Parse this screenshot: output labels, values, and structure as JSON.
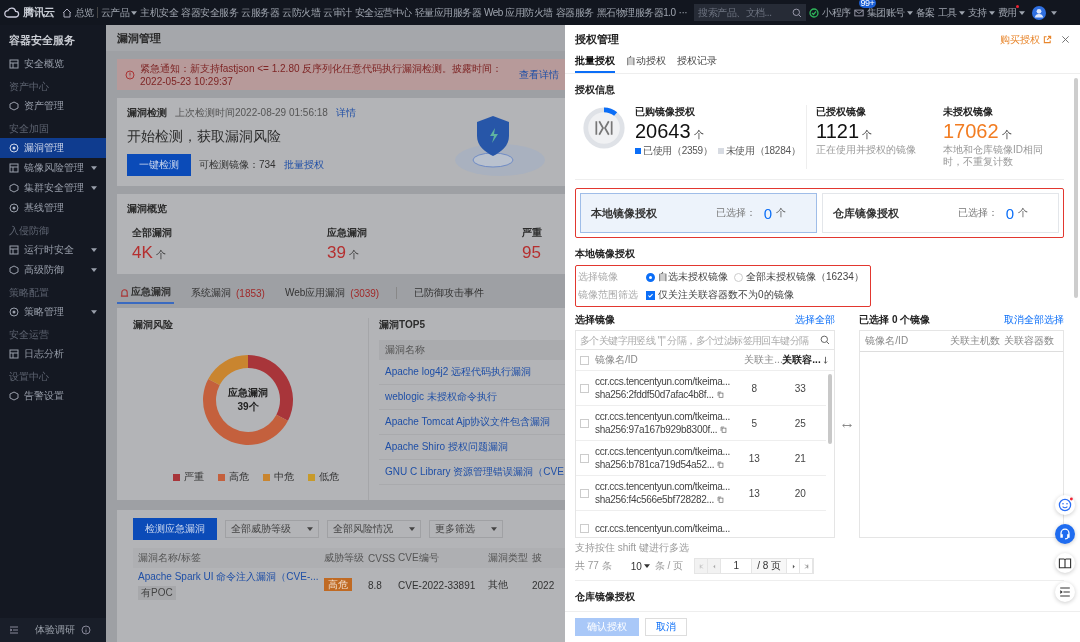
{
  "top_bar": {
    "logo": "腾讯云",
    "home": "总览",
    "nav": [
      {
        "label": "云产品",
        "dropdown": true
      },
      {
        "label": "主机安全",
        "dropdown": false
      },
      {
        "label": "容器安全服务",
        "dropdown": false
      },
      {
        "label": "云服务器",
        "dropdown": false
      },
      {
        "label": "云防火墙",
        "dropdown": false
      },
      {
        "label": "云审计",
        "dropdown": false
      },
      {
        "label": "安全运营中心",
        "dropdown": false
      },
      {
        "label": "轻量应用服务器",
        "dropdown": false
      },
      {
        "label": "Web 应用防火墙",
        "dropdown": false
      },
      {
        "label": "容器服务",
        "dropdown": false
      },
      {
        "label": "黑石物理服务器1.0",
        "dropdown": false
      }
    ],
    "more": "···",
    "search": {
      "placeholder": "搜索产品、文档..."
    },
    "mini_program": "小程序",
    "mail_badge": "99+",
    "right_menu": [
      {
        "label": "集团账号",
        "dropdown": true,
        "dot": false
      },
      {
        "label": "备案",
        "dropdown": false,
        "dot": false
      },
      {
        "label": "工具",
        "dropdown": true,
        "dot": false
      },
      {
        "label": "支持",
        "dropdown": true,
        "dot": false
      },
      {
        "label": "费用",
        "dropdown": true,
        "dot": true
      }
    ]
  },
  "sidebar": {
    "title": "容器安全服务",
    "groups": [
      {
        "items": [
          {
            "label": "安全概览",
            "selected": false,
            "expandable": false
          }
        ]
      },
      {
        "label": "资产中心",
        "items": [
          {
            "label": "资产管理",
            "selected": false,
            "expandable": false
          }
        ]
      },
      {
        "label": "安全加固",
        "items": [
          {
            "label": "漏洞管理",
            "selected": true,
            "expandable": false
          },
          {
            "label": "镜像风险管理",
            "selected": false,
            "expandable": true
          },
          {
            "label": "集群安全管理",
            "selected": false,
            "expandable": true
          },
          {
            "label": "基线管理",
            "selected": false,
            "expandable": false
          }
        ]
      },
      {
        "label": "入侵防御",
        "items": [
          {
            "label": "运行时安全",
            "selected": false,
            "expandable": true
          },
          {
            "label": "高级防御",
            "selected": false,
            "expandable": true
          }
        ]
      },
      {
        "label": "策略配置",
        "items": [
          {
            "label": "策略管理",
            "selected": false,
            "expandable": true
          }
        ]
      },
      {
        "label": "安全运营",
        "items": [
          {
            "label": "日志分析",
            "selected": false,
            "expandable": false
          }
        ]
      },
      {
        "label": "设置中心",
        "items": [
          {
            "label": "告警设置",
            "selected": false,
            "expandable": false
          }
        ]
      }
    ],
    "footer": "体验调研"
  },
  "main": {
    "page_title": "漏洞管理",
    "notice": {
      "text": "紧急通知：新支持fastjson <= 1.2.80 反序列化任意代码执行漏洞检测。披露时间：2022-05-23 10:29:37",
      "link": "查看详情"
    },
    "detection": {
      "title": "漏洞检测",
      "last_time": "上次检测时间2022-08-29 01:56:18",
      "detail_link": "详情",
      "headline": "开始检测，获取漏洞风险",
      "button": "一键检测",
      "images": "可检测镜像：734",
      "auth_link": "批量授权"
    },
    "overview": {
      "title": "漏洞概览",
      "stats": [
        {
          "label": "全部漏洞",
          "value": "4K",
          "unit": "个"
        },
        {
          "label": "应急漏洞",
          "value": "39",
          "unit": "个"
        },
        {
          "label": "严重",
          "value": "95"
        }
      ]
    },
    "tabs": [
      {
        "label": "应急漏洞",
        "selected": true
      },
      {
        "label": "系统漏洞",
        "count": "(1853)",
        "selected": false
      },
      {
        "label": "Web应用漏洞",
        "count": "(3039)",
        "selected": false
      },
      {
        "label": "已防御攻击事件",
        "selected": false
      }
    ],
    "risk": {
      "title": "漏洞风险",
      "center_label": "应急漏洞",
      "center_value": "39个",
      "legend": [
        {
          "label": "严重",
          "color": "#a8353a"
        },
        {
          "label": "高危",
          "color": "#c4603d"
        },
        {
          "label": "中危",
          "color": "#c9852f"
        },
        {
          "label": "低危",
          "color": "#c79a2a"
        }
      ]
    },
    "top5": {
      "title": "漏洞TOP5",
      "column": "漏洞名称",
      "items": [
        "Apache log4j2 远程代码执行漏洞",
        "weblogic 未授权命令执行",
        "Apache Tomcat Ajp协议文件包含漏洞",
        "Apache Shiro 授权问题漏洞",
        "GNU C Library 资源管理错误漏洞（CVE"
      ]
    },
    "vuln_table": {
      "button": "检测应急漏洞",
      "filters": [
        "全部威胁等级",
        "全部风险情况",
        "更多筛选"
      ],
      "columns": [
        "漏洞名称/标签",
        "威胁等级",
        "CVSS",
        "CVE编号",
        "漏洞类型",
        "披"
      ],
      "rows": [
        {
          "name": "Apache Spark UI 命令注入漏洞（CVE-...",
          "tag": "有POC",
          "level": "高危",
          "cvss": "8.8",
          "cve": "CVE-2022-33891",
          "type": "其他",
          "date": "2022"
        }
      ]
    }
  },
  "drawer": {
    "title": "授权管理",
    "buy_link": "购买授权",
    "tabs": [
      {
        "label": "批量授权",
        "selected": true
      },
      {
        "label": "自动授权",
        "selected": false
      },
      {
        "label": "授权记录",
        "selected": false
      }
    ],
    "info": {
      "title": "授权信息",
      "purchased": {
        "label": "已购镜像授权",
        "value": "20643",
        "unit": "个",
        "level": 0.11,
        "used": "已使用（2359）",
        "unused": "未使用（18284）"
      },
      "stats": [
        {
          "label": "已授权镜像",
          "value": "1121",
          "unit": "个",
          "note": "正在使用并授权的镜像",
          "warning": false
        },
        {
          "label": "未授权镜像",
          "value": "17062",
          "unit": "个",
          "note": "本地和仓库镜像ID相同时，不重复计数",
          "warning": true
        }
      ]
    },
    "types": [
      {
        "label": "本地镜像授权",
        "selected_label": "已选择：",
        "count": "0",
        "unit": "个",
        "selected": true
      },
      {
        "label": "仓库镜像授权",
        "selected_label": "已选择：",
        "count": "0",
        "unit": "个",
        "selected": false
      }
    ],
    "local": {
      "title": "本地镜像授权",
      "mode_label": "选择镜像",
      "modes": [
        {
          "label": "自选未授权镜像",
          "selected": true
        },
        {
          "label": "全部未授权镜像（16234）",
          "selected": false
        }
      ],
      "filter_label": "镜像范围筛选",
      "filter": {
        "label": "仅关注关联容器数不为0的镜像",
        "checked": true
      }
    },
    "transfer": {
      "left": {
        "title": "选择镜像",
        "action": "选择全部",
        "search_placeholder": "多个关键字用竖线 \"|\" 分隔，多个过滤标签用回车键分隔",
        "all_checked": false,
        "columns": [
          "镜像名/ID",
          "关联主...",
          "关联容..."
        ],
        "rows": [
          {
            "name": "ccr.ccs.tencentyun.com/tkeima...",
            "id": "sha256:2fddf50d7afac4b8f...",
            "hosts": "8",
            "containers": "33",
            "checked": false
          },
          {
            "name": "ccr.ccs.tencentyun.com/tkeima...",
            "id": "sha256:97a167b929b8300f...",
            "hosts": "5",
            "containers": "25",
            "checked": false
          },
          {
            "name": "ccr.ccs.tencentyun.com/tkeima...",
            "id": "sha256:b781ca719d54a52...",
            "hosts": "13",
            "containers": "21",
            "checked": false
          },
          {
            "name": "ccr.ccs.tencentyun.com/tkeima...",
            "id": "sha256:f4c566e5bf728282...",
            "hosts": "13",
            "containers": "20",
            "checked": false
          },
          {
            "name": "ccr.ccs.tencentyun.com/tkeima...",
            "checked": false
          }
        ],
        "hint": "支持按住 shift 键进行多选",
        "total": "共 77 条",
        "page_size": "10",
        "per_page": "条 / 页",
        "page": "1",
        "pages": "/ 8 页"
      },
      "right": {
        "title": "已选择 0 个镜像",
        "action": "取消全部选择",
        "columns": [
          "镜像名/ID",
          "关联主机数",
          "关联容器数"
        ]
      }
    },
    "repo_title": "仓库镜像授权",
    "buttons": [
      {
        "label": "确认授权",
        "primary": true,
        "disabled": true
      },
      {
        "label": "取消",
        "primary": false,
        "disabled": false
      }
    ]
  }
}
